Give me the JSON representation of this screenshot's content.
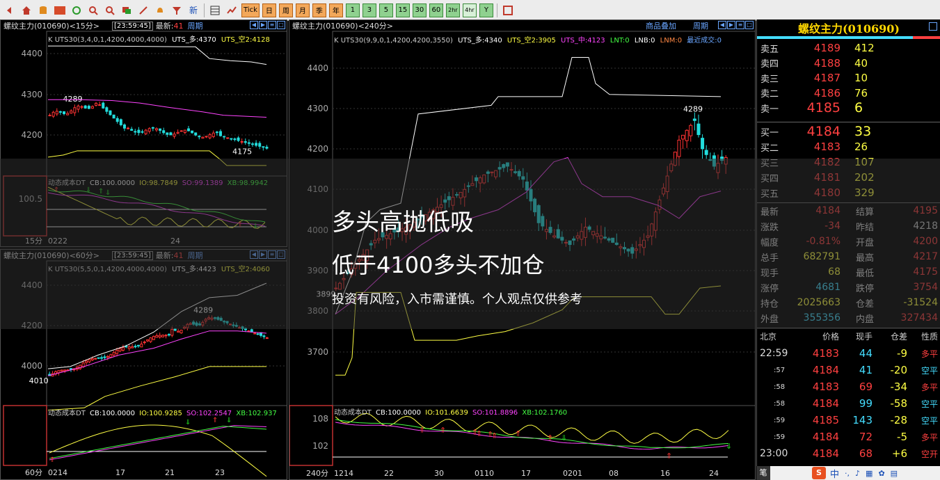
{
  "toolbar": {
    "new_label": "新",
    "tick_label": "Tick",
    "periods": [
      "日",
      "周",
      "月",
      "季",
      "年"
    ],
    "minutes": [
      "1",
      "3",
      "5",
      "15",
      "30",
      "60",
      "2hr",
      "4hr",
      "Y"
    ]
  },
  "panel15": {
    "title": "螺纹主力(010690)<15分>",
    "time": "[23:59:45]",
    "latest_label": "最新:",
    "latest": "41",
    "period": "周期",
    "indicator": "K  UTS30(3,4,0,1,4200,4000,4000)",
    "uts_duo": "UTS_多:4370",
    "uts_kong": "UTS_空2:4128",
    "yticks": [
      "4400",
      "4300",
      "4200"
    ],
    "hi_label": "4289",
    "lo_label": "4175",
    "sub_label": "动态成本DT",
    "sub_cb": "CB:100.0000",
    "sub_io": "IO:98.7849",
    "sub_so": "SO:99.1389",
    "sub_xb": "XB:98.9942",
    "sub_ytick": "100.5",
    "period_tag": "15分",
    "xticks": [
      "0222",
      "24"
    ]
  },
  "panel60": {
    "title": "螺纹主力(010690)<60分>",
    "time": "[23:59:45]",
    "latest_label": "最新:",
    "latest": "41",
    "period": "周期",
    "indicator": "K  UTS30(5,5,0,1,4200,4000,4000)",
    "uts_duo": "UTS_多:4423",
    "uts_kong": "UTS_空2:4060",
    "yticks": [
      "4400",
      "4200",
      "4000"
    ],
    "hi_label": "4289",
    "lo_label": "4010",
    "sub_label": "动态成本DT",
    "sub_cb": "CB:100.0000",
    "sub_io": "IO:100.9285",
    "sub_so": "SO:102.2547",
    "sub_xb": "XB:102.937",
    "period_tag": "60分",
    "xticks": [
      "0214",
      "17",
      "21",
      "23"
    ]
  },
  "panel240": {
    "title": "螺纹主力(010690)<240分>",
    "overlay_btn": "商品叠加",
    "period": "周期",
    "indicator": "K  UTS30(9,9,0,1,4200,4200,3550)",
    "uts_duo": "UTS_多:4340",
    "uts_kong": "UTS_空2:3905",
    "uts_zhong": "UTS_中:4123",
    "lnt": "LNT:0",
    "lnb": "LNB:0",
    "lnm": "LNM:0",
    "recent": "最近成交:0",
    "yticks": [
      "4400",
      "4300",
      "4200",
      "4100",
      "4000",
      "3900",
      "3800",
      "3700"
    ],
    "hi_label": "4289",
    "lo_label": "3899",
    "sub_label": "动态成本DT",
    "sub_cb": "CB:100.0000",
    "sub_io": "IO:101.6639",
    "sub_so": "SO:101.8896",
    "sub_xb": "XB:102.1760",
    "sub_yticks": [
      "108",
      "102"
    ],
    "period_tag": "240分",
    "xticks": [
      "1214",
      "22",
      "30",
      "0110",
      "17",
      "0201",
      "08",
      "16",
      "24"
    ]
  },
  "quote": {
    "title": "螺纹主力(010690)",
    "asks": [
      {
        "label": "卖五",
        "price": "4189",
        "vol": "412"
      },
      {
        "label": "卖四",
        "price": "4188",
        "vol": "40"
      },
      {
        "label": "卖三",
        "price": "4187",
        "vol": "10"
      },
      {
        "label": "卖二",
        "price": "4186",
        "vol": "76"
      },
      {
        "label": "卖一",
        "price": "4185",
        "vol": "6"
      }
    ],
    "bids": [
      {
        "label": "买一",
        "price": "4184",
        "vol": "33"
      },
      {
        "label": "买二",
        "price": "4183",
        "vol": "26"
      },
      {
        "label": "买三",
        "price": "4182",
        "vol": "107"
      },
      {
        "label": "买四",
        "price": "4181",
        "vol": "202"
      },
      {
        "label": "买五",
        "price": "4180",
        "vol": "329"
      }
    ],
    "stats": [
      {
        "l1": "最新",
        "v1": "4184",
        "c1": "#ff4040",
        "l2": "结算",
        "v2": "4195",
        "c2": "#ff4040"
      },
      {
        "l1": "涨跌",
        "v1": "-34",
        "c1": "#ff4040",
        "l2": "昨结",
        "v2": "4218",
        "c2": "#ccc"
      },
      {
        "l1": "幅度",
        "v1": "-0.81%",
        "c1": "#ff4040",
        "l2": "开盘",
        "v2": "4200",
        "c2": "#ff4040"
      },
      {
        "l1": "总手",
        "v1": "682791",
        "c1": "#ffff44",
        "l2": "最高",
        "v2": "4217",
        "c2": "#ff4040"
      },
      {
        "l1": "现手",
        "v1": "68",
        "c1": "#ffff44",
        "l2": "最低",
        "v2": "4175",
        "c2": "#ff4040"
      },
      {
        "l1": "涨停",
        "v1": "4681",
        "c1": "#44ddff",
        "l2": "跌停",
        "v2": "3754",
        "c2": "#ff4040"
      },
      {
        "l1": "持仓",
        "v1": "2025663",
        "c1": "#ffff44",
        "l2": "仓差",
        "v2": "-31524",
        "c2": "#ffff44"
      },
      {
        "l1": "外盘",
        "v1": "355356",
        "c1": "#44ddff",
        "l2": "内盘",
        "v2": "327434",
        "c2": "#ff4040"
      }
    ],
    "tick_header": {
      "loc": "北京",
      "price": "价格",
      "vol": "现手",
      "diff": "仓差",
      "nature": "性质"
    },
    "ticks": [
      {
        "time": "22:59",
        "price": "4183",
        "vol": "44",
        "diff": "-9",
        "nature": "多平",
        "nc": "#ff4040"
      },
      {
        "time": ":57",
        "price": "4184",
        "vol": "41",
        "diff": "-20",
        "nature": "空平",
        "nc": "#44ddff"
      },
      {
        "time": ":58",
        "price": "4183",
        "vol": "69",
        "diff": "-34",
        "nature": "多平",
        "nc": "#ff4040"
      },
      {
        "time": ":58",
        "price": "4184",
        "vol": "99",
        "diff": "-58",
        "nature": "空平",
        "nc": "#44ddff"
      },
      {
        "time": ":59",
        "price": "4185",
        "vol": "143",
        "diff": "-28",
        "nature": "空平",
        "nc": "#44ddff"
      },
      {
        "time": ":59",
        "price": "4184",
        "vol": "72",
        "diff": "-5",
        "nature": "多平",
        "nc": "#ff4040"
      },
      {
        "time": "23:00",
        "price": "4184",
        "vol": "68",
        "diff": "+6",
        "nature": "空开",
        "nc": "#ff4040"
      }
    ],
    "footer_tab": "笔"
  },
  "overlay": {
    "line1": "多头高抛低吸",
    "line2": "低于4100多头不加仓",
    "line3": "投资有风险，入市需谨慎。个人观点仅供参考"
  },
  "ime": {
    "brand": "S",
    "lang": "中"
  }
}
